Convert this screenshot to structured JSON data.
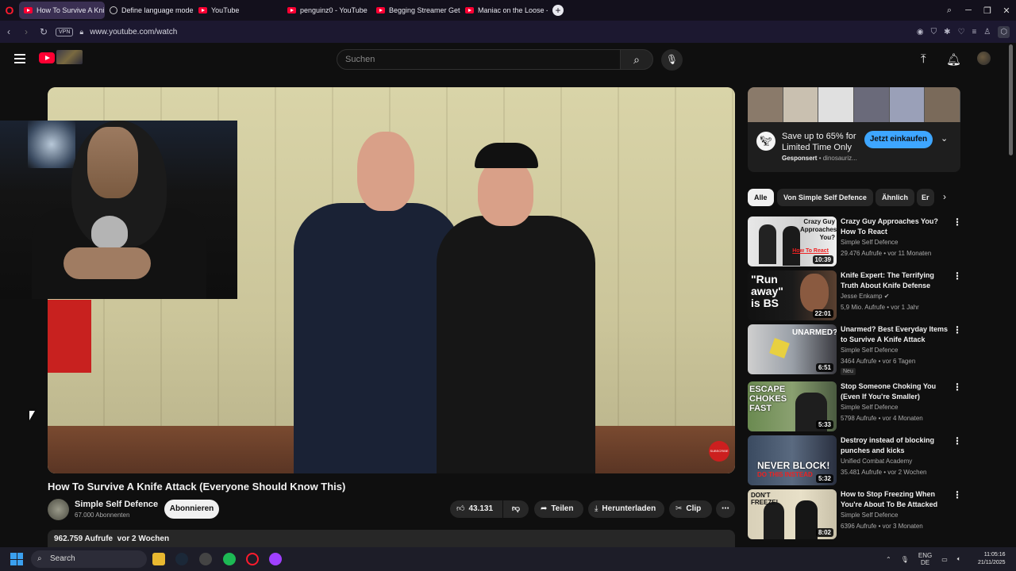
{
  "browser": {
    "tabs": [
      {
        "label": "How To Survive A Kni",
        "type": "youtube",
        "active": true
      },
      {
        "label": "Define language model",
        "type": "globe",
        "active": false
      },
      {
        "label": "YouTube",
        "type": "youtube",
        "active": false
      },
      {
        "label": "penguinz0 - YouTube",
        "type": "youtube",
        "active": false
      },
      {
        "label": "Begging Streamer Gets Ca",
        "type": "youtube",
        "active": false
      },
      {
        "label": "Maniac on the Loose - Yo",
        "type": "youtube",
        "active": false
      }
    ],
    "url": "www.youtube.com/watch",
    "vpn_label": "VPN"
  },
  "header": {
    "search_placeholder": "Suchen"
  },
  "video": {
    "title": "How To Survive A Knife Attack (Everyone Should Know This)",
    "channel": "Simple Self Defence",
    "subscribers": "67.000 Abonnenten",
    "subscribe_label": "Abonnieren",
    "likes": "43.131",
    "share_label": "Teilen",
    "download_label": "Herunterladen",
    "clip_label": "Clip",
    "views": "962.759 Aufrufe",
    "date": "vor 2 Wochen",
    "overlay_badge": "SUBSCRIBE"
  },
  "ad": {
    "title": "Save up to 65% for Limited Time Only",
    "sponsored": "Gesponsert",
    "domain": "dinosauriz...",
    "button": "Jetzt einkaufen"
  },
  "chips": [
    "Alle",
    "Von Simple Self Defence",
    "Ähnlich",
    "Er"
  ],
  "recommendations": [
    {
      "title": "Crazy Guy Approaches You? How To React",
      "channel": "Simple Self Defence",
      "meta": "29.476 Aufrufe • vor 11 Monaten",
      "duration": "10:39",
      "thumb_text": "Crazy Guy Approaches You?",
      "thumb_text2": "How To React"
    },
    {
      "title": "Knife Expert: The Terrifying Truth About Knife Defense",
      "channel": "Jesse Enkamp",
      "meta": "5,9 Mio. Aufrufe • vor 1 Jahr",
      "duration": "22:01",
      "thumb_text": "\"Run away\" is BS"
    },
    {
      "title": "Unarmed? Best Everyday Items to Survive A Knife Attack",
      "channel": "Simple Self Defence",
      "meta": "3464 Aufrufe • vor 6 Tagen",
      "duration": "6:51",
      "thumb_text": "UNARMED?",
      "badge": "Neu"
    },
    {
      "title": "Stop Someone Choking You (Even If You're Smaller)",
      "channel": "Simple Self Defence",
      "meta": "5798 Aufrufe • vor 4 Monaten",
      "duration": "5:33",
      "thumb_text": "ESCAPE CHOKES FAST"
    },
    {
      "title": "Destroy instead of blocking punches and kicks",
      "channel": "Unified Combat Academy",
      "meta": "35.481 Aufrufe • vor 2 Wochen",
      "duration": "5:32",
      "thumb_text": "NEVER BLOCK!",
      "thumb_text2": "DO THIS INSTEAD"
    },
    {
      "title": "How to Stop Freezing When You're About To Be Attacked",
      "channel": "Simple Self Defence",
      "meta": "6396 Aufrufe • vor 3 Monaten",
      "duration": "8:02",
      "thumb_text": "DON'T FREEZE!"
    }
  ],
  "taskbar": {
    "search_label": "Search",
    "lang1": "ENG",
    "lang2": "DE",
    "time": "11:05:16",
    "date": "21/11/2025"
  },
  "colors": {
    "accent": "#3ea6ff",
    "yt_red": "#ff0033",
    "opera_red": "#ff1b2d"
  }
}
